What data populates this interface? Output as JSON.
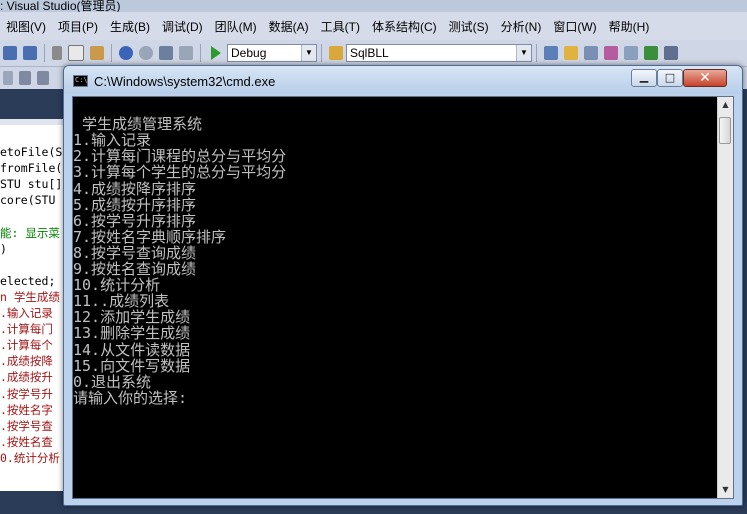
{
  "ide": {
    "title": ": Visual Studio(管理员)",
    "menu": [
      "视图(V)",
      "项目(P)",
      "生成(B)",
      "调试(D)",
      "团队(M)",
      "数据(A)",
      "工具(T)",
      "体系结构(C)",
      "测试(S)",
      "分析(N)",
      "窗口(W)",
      "帮助(H)"
    ],
    "config_combo": "Debug",
    "solution_combo": "SqlBLL",
    "code_lines": [
      {
        "text": "etoFile(S",
        "color": "#000000"
      },
      {
        "text": "fromFile(",
        "color": "#000000"
      },
      {
        "text": "STU stu[],",
        "color": "#000000"
      },
      {
        "text": "core(STU ",
        "color": "#000000"
      },
      {
        "text": "",
        "color": "#000000"
      },
      {
        "text": "能: 显示菜",
        "color": "#008000"
      },
      {
        "text": ")",
        "color": "#000000"
      },
      {
        "text": "",
        "color": "#000000"
      },
      {
        "text": "elected;",
        "color": "#000000"
      },
      {
        "text": "n 学生成绩",
        "color": "#a31515"
      },
      {
        "text": ".输入记录",
        "color": "#a31515"
      },
      {
        "text": ".计算每门",
        "color": "#a31515"
      },
      {
        "text": ".计算每个",
        "color": "#a31515"
      },
      {
        "text": ".成绩按降",
        "color": "#a31515"
      },
      {
        "text": ".成绩按升",
        "color": "#a31515"
      },
      {
        "text": ".按学号升",
        "color": "#a31515"
      },
      {
        "text": ".按姓名字",
        "color": "#a31515"
      },
      {
        "text": ".按学号查",
        "color": "#a31515"
      },
      {
        "text": ".按姓名查",
        "color": "#a31515"
      },
      {
        "text": "0.统计分析",
        "color": "#a31515"
      }
    ]
  },
  "cmd": {
    "title": "C:\\Windows\\system32\\cmd.exe",
    "lines": [
      "",
      " 学生成绩管理系统",
      "1.输入记录",
      "2.计算每门课程的总分与平均分",
      "3.计算每个学生的总分与平均分",
      "4.成绩按降序排序",
      "5.成绩按升序排序",
      "6.按学号升序排序",
      "7.按姓名字典顺序排序",
      "8.按学号查询成绩",
      "9.按姓名查询成绩",
      "10.统计分析",
      "11..成绩列表",
      "12.添加学生成绩",
      "13.删除学生成绩",
      "14.从文件读数据",
      "15.向文件写数据",
      "0.退出系统",
      "请输入你的选择:"
    ]
  }
}
